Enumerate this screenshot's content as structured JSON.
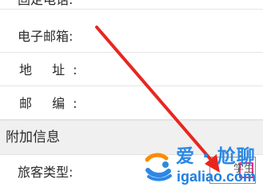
{
  "form": {
    "fixed_phone_label": "固定电话:",
    "email_label": "电子邮箱:",
    "address_label": "地 址:",
    "postal_label": "邮 编:",
    "section_title": "附加信息",
    "passenger_type_label": "旅客类型:",
    "passenger_type_value": "学生"
  },
  "watermark": {
    "brand_cn": "爱 · 尬聊",
    "url": "igaliao.com"
  },
  "colors": {
    "arrow": "#e8261f",
    "highlight": "#ff2e8a",
    "watermark_blue": "#2b88e6",
    "watermark_orange": "#ff8a00"
  }
}
